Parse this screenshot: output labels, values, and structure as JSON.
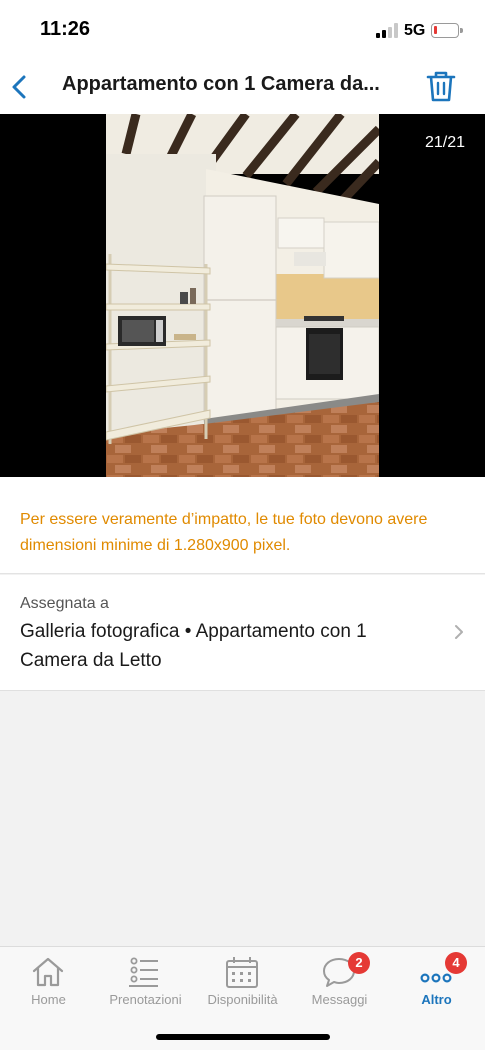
{
  "status_bar": {
    "time": "11:26",
    "network": "5G",
    "battery_level": 0.15
  },
  "header": {
    "title": "Appartamento con 1 Camera da...",
    "back_icon": "chevron-left-icon",
    "delete_icon": "trash-icon"
  },
  "photo": {
    "counter": "21/21"
  },
  "warning": {
    "text": "Per essere veramente d’impatto, le tue foto devono avere dimensioni minime di 1.280x900 pixel."
  },
  "assignment": {
    "label": "Assegnata a",
    "value": "Galleria fotografica • Appartamento con 1 Camera da Letto"
  },
  "tab_bar": {
    "tabs": [
      {
        "label": "Home",
        "icon": "home-icon"
      },
      {
        "label": "Prenotazioni",
        "icon": "list-icon"
      },
      {
        "label": "Disponibilità",
        "icon": "calendar-icon"
      },
      {
        "label": "Messaggi",
        "icon": "chat-icon",
        "badge": "2"
      },
      {
        "label": "Altro",
        "icon": "more-icon",
        "badge": "4"
      }
    ],
    "active_index": 4
  },
  "colors": {
    "accent": "#1c75bc",
    "warning": "#e08a00",
    "badge": "#e53935"
  }
}
